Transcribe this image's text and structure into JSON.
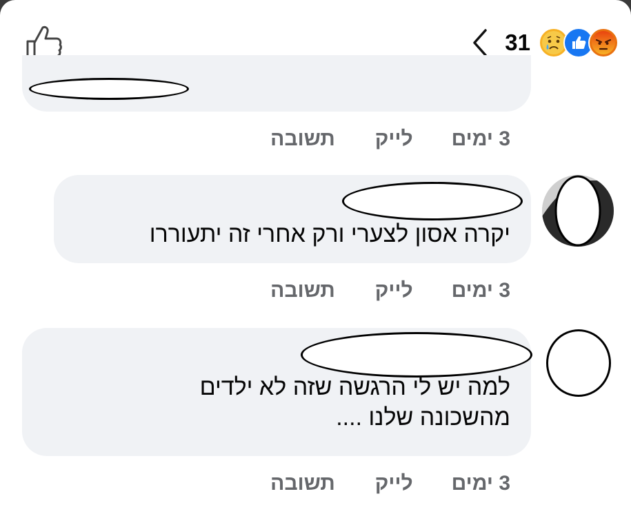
{
  "header": {
    "reaction_count": "31",
    "reactions": [
      "sad-reaction",
      "like-reaction",
      "angry-reaction"
    ],
    "colors": {
      "like_blue": "#1877f2",
      "sad_yellow": "#f7b125",
      "angry_orange": "#e9710f"
    }
  },
  "comments": [
    {
      "text": "",
      "time": "3 ימים",
      "like_label": "לייק",
      "reply_label": "תשובה"
    },
    {
      "text": "יקרה אסון לצערי ורק אחרי זה יתעוררו",
      "time": "3 ימים",
      "like_label": "לייק",
      "reply_label": "תשובה"
    },
    {
      "text_line1": "למה יש לי הרגשה שזה לא ילדים",
      "text_line2": "מהשכונה שלנו ....",
      "time": "3 ימים",
      "like_label": "לייק",
      "reply_label": "תשובה"
    }
  ],
  "colors": {
    "bubble_bg": "#f0f2f5",
    "meta_text": "#65676b",
    "body_text": "#050505"
  }
}
